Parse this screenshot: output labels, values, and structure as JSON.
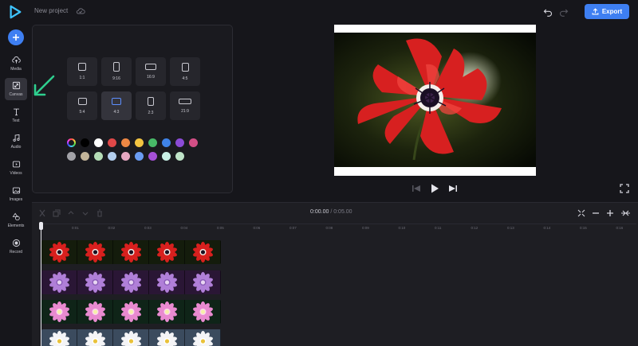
{
  "header": {
    "project_name": "New project",
    "export_label": "Export"
  },
  "sidebar": {
    "items": [
      {
        "label": "Media",
        "icon": "cloud-upload-icon"
      },
      {
        "label": "Canvas",
        "icon": "resize-icon"
      },
      {
        "label": "Text",
        "icon": "text-icon"
      },
      {
        "label": "Audio",
        "icon": "music-note-icon"
      },
      {
        "label": "Videos",
        "icon": "video-icon"
      },
      {
        "label": "Images",
        "icon": "image-icon"
      },
      {
        "label": "Elements",
        "icon": "shapes-icon"
      },
      {
        "label": "Record",
        "icon": "record-icon"
      }
    ]
  },
  "canvas": {
    "ratios": [
      "1:1",
      "9:16",
      "16:9",
      "4:5",
      "5:4",
      "4:3",
      "2:3",
      "21:9"
    ],
    "selected_ratio": "4:3",
    "colors_row1": [
      "#000000",
      "#ffffff",
      "#e04848",
      "#ee8844",
      "#f2c441",
      "#48b968",
      "#3f83e8",
      "#8b4bd6",
      "#d34f86"
    ],
    "colors_row2": [
      "#a2a2a8",
      "#c3b59a",
      "#b5ddb6",
      "#b3cfee",
      "#e7a8c2",
      "#6a9cf3",
      "#a450d6",
      "#c9f0e6",
      "#bfe3c8"
    ]
  },
  "timeline": {
    "current_time": "0:00.00",
    "separator": "/",
    "total_time": "0:05.00",
    "ruler": [
      "0:01",
      "0:02",
      "0:03",
      "0:04",
      "0:05",
      "0:06",
      "0:07",
      "0:08",
      "0:09",
      "0:10",
      "0:11",
      "0:12",
      "0:13",
      "0:14",
      "0:15",
      "0:16"
    ]
  },
  "colors": {
    "accent": "#3e7ff2",
    "annotation_arrow": "#2ecf8f"
  }
}
